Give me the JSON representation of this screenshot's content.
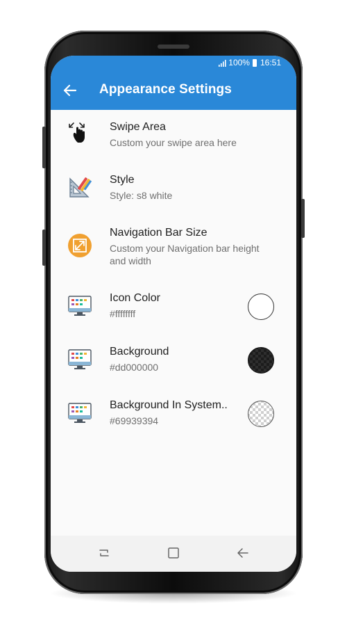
{
  "status_bar": {
    "battery": "100%",
    "time": "16:51"
  },
  "toolbar": {
    "title": "Appearance Settings",
    "back_icon": "arrow-left-icon"
  },
  "settings": [
    {
      "icon": "swipe-hand-icon",
      "title": "Swipe Area",
      "subtitle": "Custom your swipe area here"
    },
    {
      "icon": "style-ruler-icon",
      "title": "Style",
      "subtitle": "Style: s8 white"
    },
    {
      "icon": "resize-icon",
      "title": "Navigation Bar Size",
      "subtitle": "Custom your Navigation bar height and width"
    },
    {
      "icon": "monitor-icon",
      "title": "Icon Color",
      "subtitle": "#ffffffff",
      "swatch_color": "#ffffff"
    },
    {
      "icon": "monitor-icon",
      "title": "Background",
      "subtitle": "#dd000000",
      "swatch_color": "#222222"
    },
    {
      "icon": "monitor-icon",
      "title": "Background In System..",
      "subtitle": "#69939394",
      "swatch_color": "transparent-checker"
    }
  ],
  "navigation_bar": {
    "buttons": [
      "recent-apps-icon",
      "home-icon",
      "back-icon"
    ]
  },
  "colors": {
    "accent": "#2a88d8",
    "background": "#fafafa",
    "navbar": "#f2f2f2",
    "resize_icon": "#f0a030"
  }
}
